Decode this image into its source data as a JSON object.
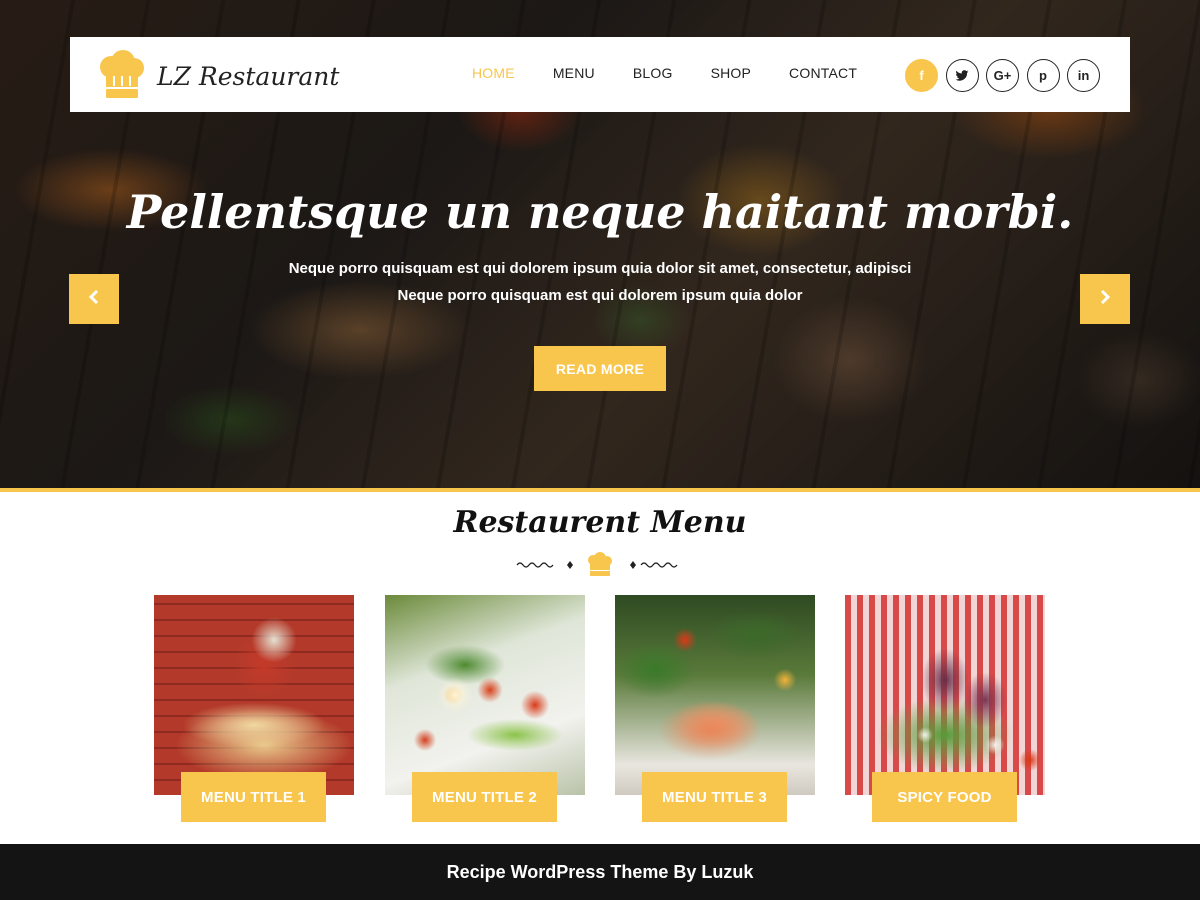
{
  "brand": {
    "name": "LZ Restaurant",
    "logo_icon": "chef-hat-icon"
  },
  "nav": {
    "items": [
      {
        "label": "HOME",
        "active": true
      },
      {
        "label": "MENU",
        "active": false
      },
      {
        "label": "BLOG",
        "active": false
      },
      {
        "label": "SHOP",
        "active": false
      },
      {
        "label": "CONTACT",
        "active": false
      }
    ]
  },
  "social": [
    {
      "icon": "facebook-icon",
      "glyph": "f",
      "active": true
    },
    {
      "icon": "twitter-icon",
      "glyph": "t",
      "active": false
    },
    {
      "icon": "google-plus-icon",
      "glyph": "G+",
      "active": false
    },
    {
      "icon": "pinterest-icon",
      "glyph": "p",
      "active": false
    },
    {
      "icon": "linkedin-icon",
      "glyph": "in",
      "active": false
    }
  ],
  "hero": {
    "title": "Pellentsque un neque haitant morbi.",
    "subtitle_line1": "Neque porro quisquam est qui dolorem ipsum quia dolor sit amet, consectetur, adipisci",
    "subtitle_line2": "Neque porro quisquam est qui dolorem ipsum quia dolor",
    "button_label": "READ MORE"
  },
  "menu_section": {
    "title": "Restaurent Menu",
    "items": [
      {
        "label": "MENU TITLE 1"
      },
      {
        "label": "MENU TITLE 2"
      },
      {
        "label": "MENU TITLE 3"
      },
      {
        "label": "SPICY FOOD"
      }
    ]
  },
  "footer": {
    "text": "Recipe WordPress Theme By Luzuk"
  },
  "colors": {
    "accent": "#f9c64d",
    "footer_bg": "#141414",
    "text_dark": "#222222"
  }
}
